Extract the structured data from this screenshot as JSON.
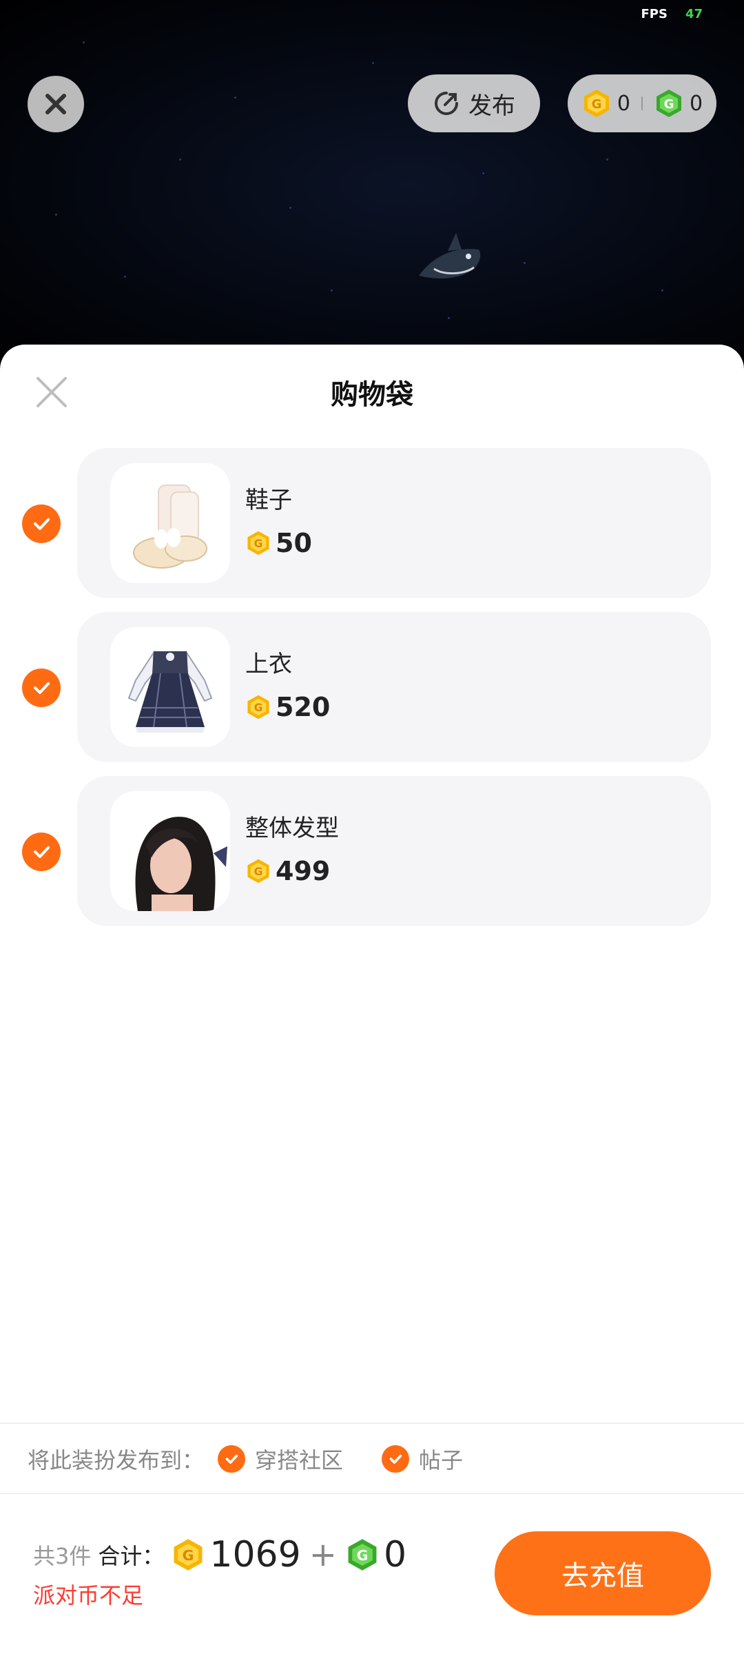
{
  "status": {
    "fps_label": "FPS",
    "fps_value": "47"
  },
  "top_bar": {
    "publish_label": "发布",
    "gold_coins": "0",
    "green_coins": "0"
  },
  "sheet": {
    "title": "购物袋",
    "items": [
      {
        "name": "鞋子",
        "price": "50",
        "checked": true
      },
      {
        "name": "上衣",
        "price": "520",
        "checked": true
      },
      {
        "name": "整体发型",
        "price": "499",
        "checked": true
      }
    ]
  },
  "publish_to": {
    "label": "将此装扮发布到：",
    "options": [
      "穿搭社区",
      "帖子"
    ]
  },
  "footer": {
    "count_text": "共3件",
    "total_label": "合计：",
    "gold_total": "1069",
    "plus": "+",
    "green_total": "0",
    "warning": "派对币不足",
    "recharge_label": "去充值"
  },
  "colors": {
    "accent": "#ff7117",
    "gold": "#f7b500",
    "green": "#4cc23a",
    "warning": "#ff3b30"
  }
}
